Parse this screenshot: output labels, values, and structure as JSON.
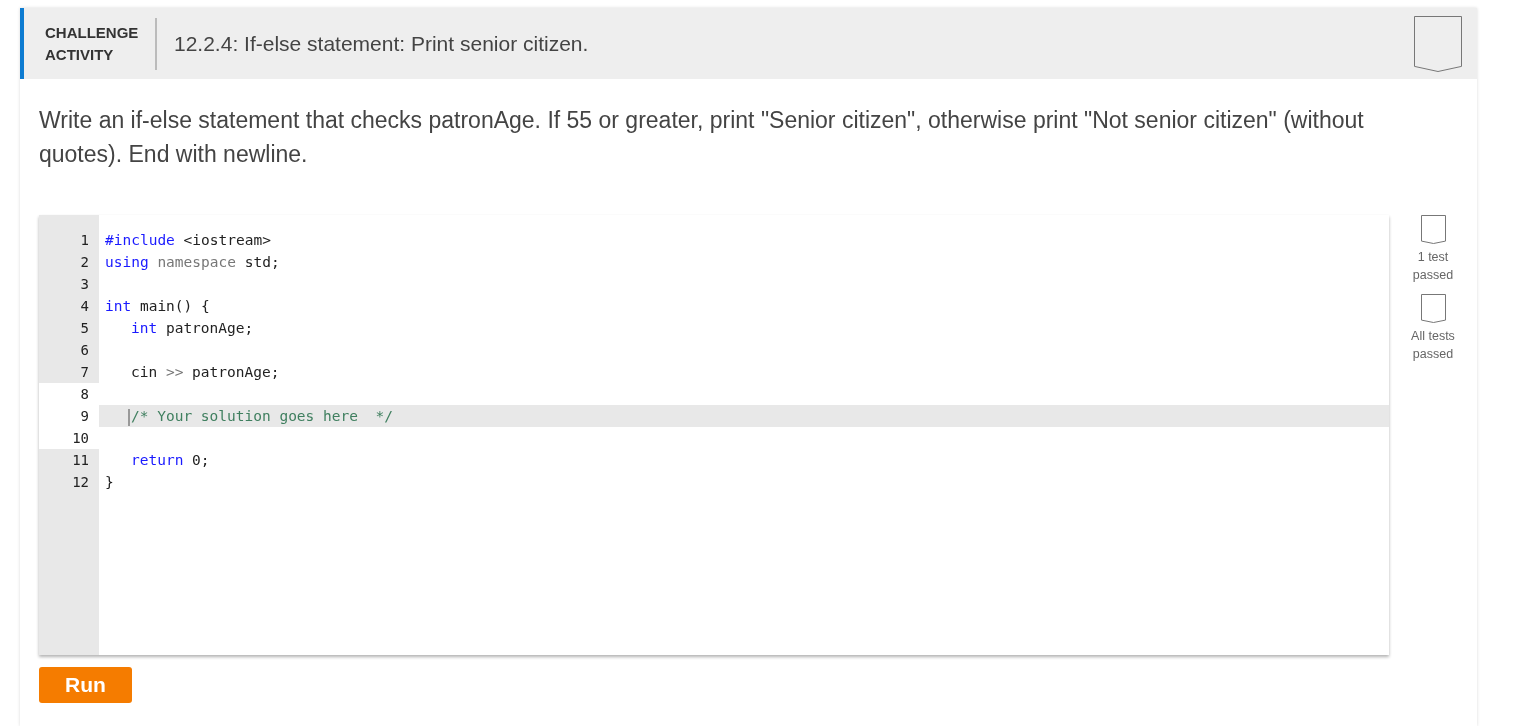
{
  "activity": {
    "label_line1": "CHALLENGE",
    "label_line2": "ACTIVITY",
    "title": "12.2.4: If-else statement: Print senior citizen.",
    "completed": false
  },
  "instructions": "Write an if-else statement that checks patronAge. If 55 or greater, print \"Senior citizen\", otherwise print \"Not senior citizen\" (without quotes). End with newline.",
  "editor": {
    "lines": [
      {
        "number": "1",
        "editable": false,
        "active": false,
        "tokens": [
          {
            "kind": "keyword",
            "text": "#include"
          },
          {
            "kind": "plain",
            "text": " <iostream>"
          }
        ]
      },
      {
        "number": "2",
        "editable": false,
        "active": false,
        "tokens": [
          {
            "kind": "keyword",
            "text": "using "
          },
          {
            "kind": "dim",
            "text": "namespace"
          },
          {
            "kind": "plain",
            "text": " std;"
          }
        ]
      },
      {
        "number": "3",
        "editable": false,
        "active": false
      },
      {
        "number": "4",
        "editable": false,
        "active": false,
        "tokens": [
          {
            "kind": "keyword",
            "text": "int"
          },
          {
            "kind": "plain",
            "text": " main() {"
          }
        ]
      },
      {
        "number": "5",
        "editable": false,
        "active": false,
        "indented": true,
        "tokens": [
          {
            "kind": "keyword",
            "text": "int"
          },
          {
            "kind": "plain",
            "text": " patronAge;"
          }
        ]
      },
      {
        "number": "6",
        "editable": false,
        "active": false
      },
      {
        "number": "7",
        "editable": false,
        "active": false,
        "indented": true,
        "tokens": [
          {
            "kind": "plain",
            "text": "cin "
          },
          {
            "kind": "dim",
            "text": ">>"
          },
          {
            "kind": "plain",
            "text": " patronAge;"
          }
        ]
      },
      {
        "number": "8",
        "editable": true,
        "active": false
      },
      {
        "number": "9",
        "editable": true,
        "active": true,
        "indented": true,
        "tokens": [
          {
            "kind": "comment",
            "text": "/* Your solution goes here  */"
          }
        ]
      },
      {
        "number": "10",
        "editable": true,
        "active": false
      },
      {
        "number": "11",
        "editable": false,
        "active": false,
        "indented": true,
        "tokens": [
          {
            "kind": "keyword",
            "text": "return"
          },
          {
            "kind": "plain",
            "text": " 0;"
          }
        ]
      },
      {
        "number": "12",
        "editable": false,
        "active": false,
        "tokens": [
          {
            "kind": "plain",
            "text": "}"
          }
        ]
      }
    ]
  },
  "tests": [
    {
      "label": "1 test passed",
      "passed": false
    },
    {
      "label": "All tests passed",
      "passed": false
    }
  ],
  "run_button": "Run"
}
